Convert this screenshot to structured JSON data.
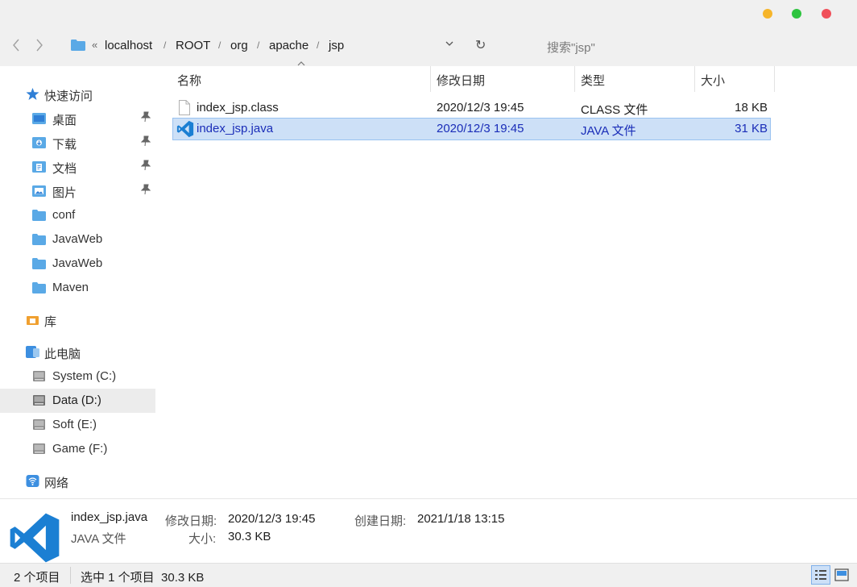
{
  "window": {
    "controls": {
      "minimize": "#f6b52a",
      "maximize": "#2ec43f",
      "close": "#f0505a"
    }
  },
  "toolbar": {
    "back_icon": "chevron-left-icon",
    "forward_icon": "chevron-right-icon",
    "overflow": "«",
    "breadcrumb": [
      "localhost",
      "ROOT",
      "org",
      "apache",
      "jsp"
    ],
    "separator": "/",
    "dropdown_icon": "chevron-down-icon",
    "refresh_glyph": "↻",
    "search_placeholder": "搜索\"jsp\""
  },
  "sidebar": {
    "quick_access": "快速访问",
    "pinned": [
      "桌面",
      "下载",
      "文档",
      "图片"
    ],
    "folders": [
      "conf",
      "JavaWeb",
      "JavaWeb",
      "Maven"
    ],
    "library": "库",
    "this_pc": "此电脑",
    "drives": [
      "System (C:)",
      "Data (D:)",
      "Soft (E:)",
      "Game (F:)"
    ],
    "network": "网络",
    "selected": "Data (D:)"
  },
  "columns": {
    "name": "名称",
    "modified": "修改日期",
    "type": "类型",
    "size": "大小"
  },
  "files": [
    {
      "name": "index_jsp.class",
      "modified": "2020/12/3 19:45",
      "type": "CLASS 文件",
      "size": "18 KB",
      "icon": "file-icon",
      "selected": false
    },
    {
      "name": "index_jsp.java",
      "modified": "2020/12/3 19:45",
      "type": "JAVA 文件",
      "size": "31 KB",
      "icon": "vscode-icon",
      "selected": true
    }
  ],
  "details": {
    "name": "index_jsp.java",
    "type": "JAVA 文件",
    "modified_label": "修改日期:",
    "modified_value": "2020/12/3 19:45",
    "size_label": "大小:",
    "size_value": "30.3 KB",
    "created_label": "创建日期:",
    "created_value": "2021/1/18 13:15"
  },
  "status": {
    "count": "2 个项目",
    "selection": "选中 1 个项目  30.3 KB"
  },
  "colors": {
    "accent": "#1a2db8",
    "selection_bg": "#cde0f7",
    "folder": "#5aa9e6",
    "vscode": "#1b7fd3"
  }
}
